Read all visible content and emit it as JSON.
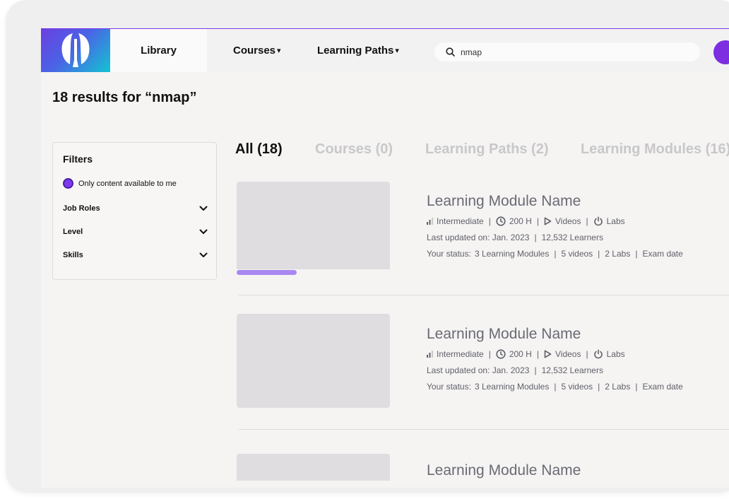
{
  "nav": {
    "library": "Library",
    "courses": "Courses",
    "learning_paths": "Learning Paths",
    "caret": "▾"
  },
  "search": {
    "value": "nmap",
    "placeholder": "Search"
  },
  "results_title": "18 results for “nmap”",
  "filters": {
    "title": "Filters",
    "only_available": "Only content available to me",
    "groups": [
      "Job Roles",
      "Level",
      "Skills"
    ]
  },
  "tabs": [
    "All (18)",
    "Courses (0)",
    "Learning Paths (2)",
    "Learning Modules (16)"
  ],
  "active_tab": "All (18)",
  "results": [
    {
      "title": "Learning Module Name",
      "level": "Intermediate",
      "duration": "200 H",
      "videos": "Videos",
      "labs": "Labs",
      "updated": "Last updated on: Jan. 2023",
      "learners": "12,532 Learners",
      "status_label": "Your status:",
      "status_modules": "3 Learning Modules",
      "status_videos": "5 videos",
      "status_labs": "2 Labs",
      "status_exam": "Exam date",
      "progress": 0.39
    },
    {
      "title": "Learning Module Name",
      "level": "Intermediate",
      "duration": "200 H",
      "videos": "Videos",
      "labs": "Labs",
      "updated": "Last updated on: Jan. 2023",
      "learners": "12,532 Learners",
      "status_label": "Your status:",
      "status_modules": "3 Learning Modules",
      "status_videos": "5 videos",
      "status_labs": "2 Labs",
      "status_exam": "Exam date"
    },
    {
      "title": "Learning Module Name"
    }
  ],
  "colors": {
    "accent": "#7c3aed",
    "progress": "#a987f0",
    "thumb": "#dfdde0"
  },
  "icons": [
    "logo-icon",
    "search-icon",
    "chevron-down-icon",
    "level-bars-icon",
    "clock-icon",
    "play-icon",
    "power-icon"
  ]
}
